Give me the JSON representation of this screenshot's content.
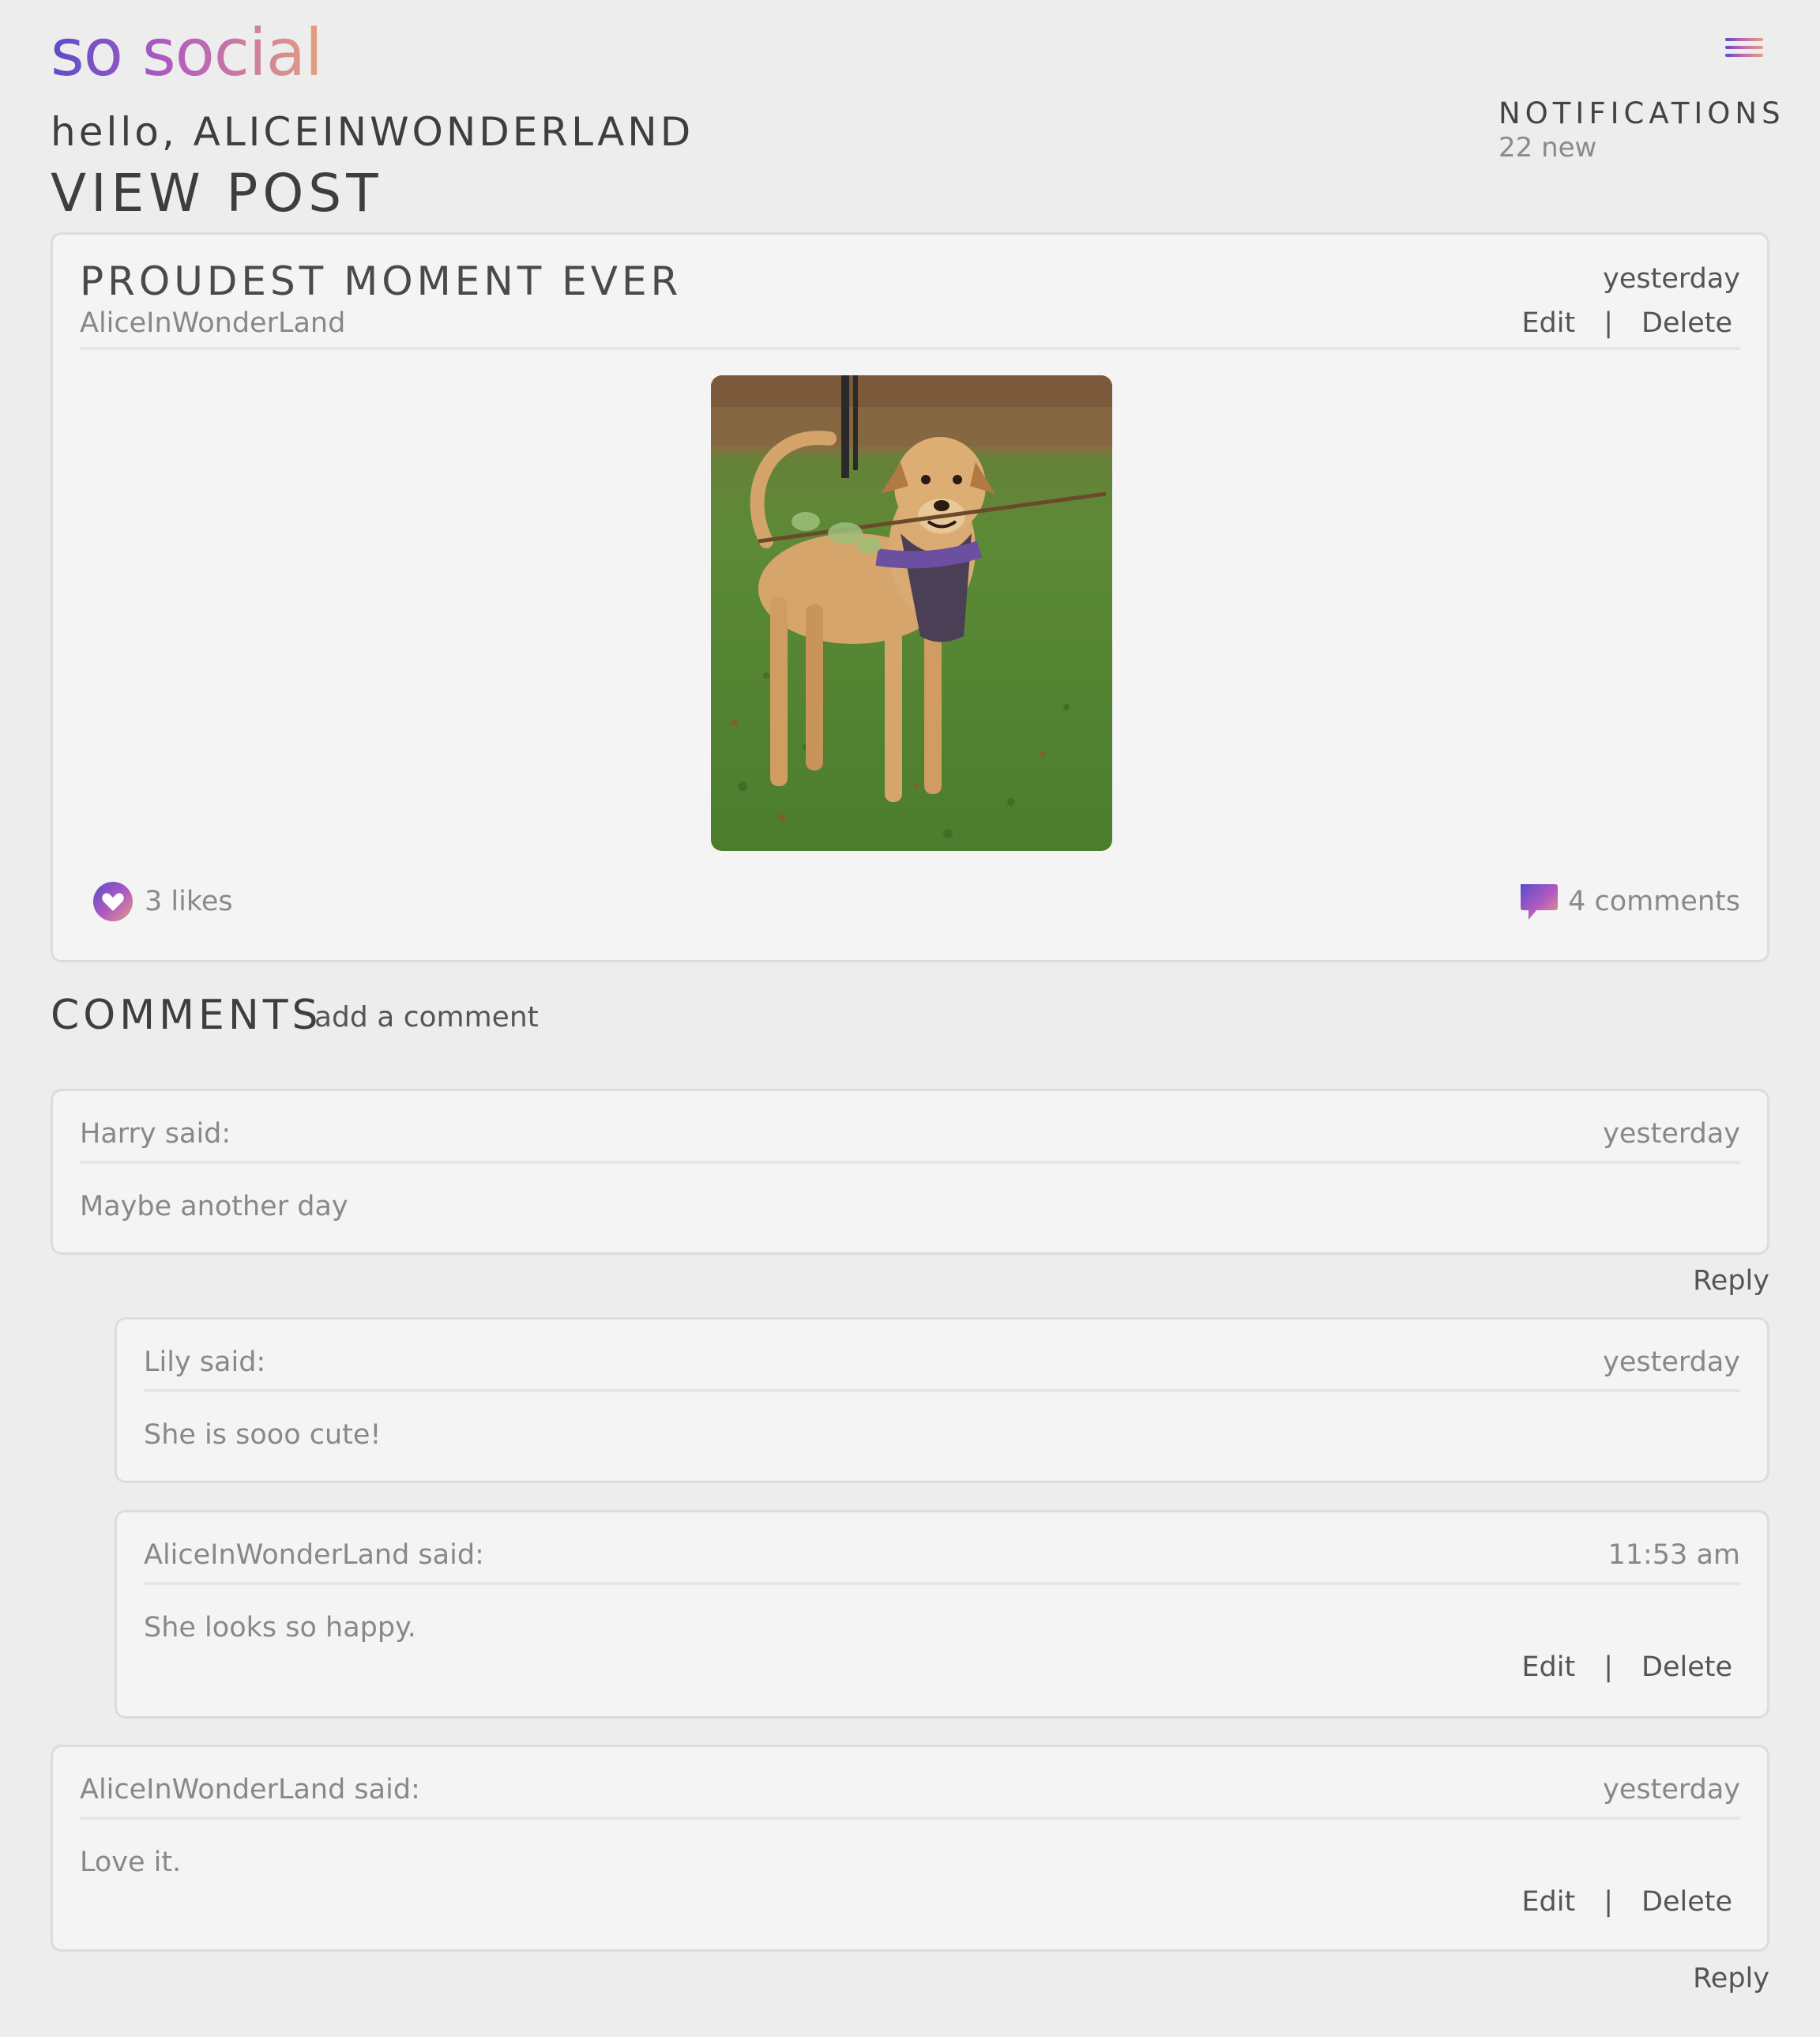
{
  "brand": {
    "logo": "so social"
  },
  "header": {
    "greeting": "hello, ALICEINWONDERLAND",
    "page_title": "VIEW POST",
    "notifications": {
      "title": "NOTIFICATIONS",
      "count": "22 new"
    }
  },
  "post": {
    "title": "PROUDEST MOMENT EVER",
    "date": "yesterday",
    "author": "AliceInWonderLand",
    "edit_label": "Edit",
    "separator": "|",
    "delete_label": "Delete",
    "likes": "3 likes",
    "comments": "4 comments"
  },
  "comments_section": {
    "heading": "COMMENTS",
    "add_label": "add a comment",
    "items": [
      {
        "author": "Harry said:",
        "date": "yesterday",
        "text": "Maybe another day",
        "reply_label": "Reply"
      },
      {
        "author": "Lily said:",
        "date": "yesterday",
        "text": "She is sooo cute!"
      },
      {
        "author": "AliceInWonderLand said:",
        "date": "11:53 am",
        "text": "She looks so happy.",
        "edit_label": "Edit",
        "separator": "|",
        "delete_label": "Delete"
      },
      {
        "author": "AliceInWonderLand said:",
        "date": "yesterday",
        "text": "Love it.",
        "edit_label": "Edit",
        "separator": "|",
        "delete_label": "Delete",
        "reply_label": "Reply"
      }
    ]
  },
  "colors": {
    "gradient_start": "#5a4cc9",
    "gradient_mid": "#b35bc0",
    "gradient_end": "#e3a07d",
    "background": "#ededed",
    "card": "#f4f4f4"
  },
  "icons": [
    "menu-icon",
    "heart-icon",
    "comment-icon"
  ]
}
